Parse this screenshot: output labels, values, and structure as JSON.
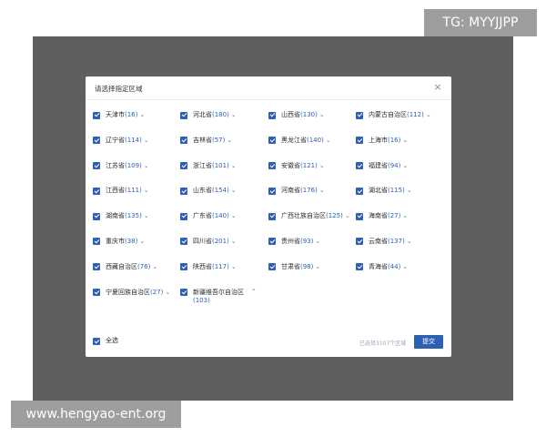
{
  "dialog": {
    "title": "请选择指定区域",
    "close_glyph": "×",
    "regions": [
      [
        {
          "name": "天津市",
          "count": "(16)"
        },
        {
          "name": "河北省",
          "count": "(180)"
        },
        {
          "name": "山西省",
          "count": "(130)"
        },
        {
          "name": "内蒙古自治区",
          "count": "(112)"
        }
      ],
      [
        {
          "name": "辽宁省",
          "count": "(114)"
        },
        {
          "name": "吉林省",
          "count": "(57)"
        },
        {
          "name": "黑龙江省",
          "count": "(140)"
        },
        {
          "name": "上海市",
          "count": "(16)"
        }
      ],
      [
        {
          "name": "江苏省",
          "count": "(109)"
        },
        {
          "name": "浙江省",
          "count": "(101)"
        },
        {
          "name": "安徽省",
          "count": "(121)"
        },
        {
          "name": "福建省",
          "count": "(94)"
        }
      ],
      [
        {
          "name": "江西省",
          "count": "(111)"
        },
        {
          "name": "山东省",
          "count": "(154)"
        },
        {
          "name": "河南省",
          "count": "(176)"
        },
        {
          "name": "湖北省",
          "count": "(115)"
        }
      ],
      [
        {
          "name": "湖南省",
          "count": "(135)"
        },
        {
          "name": "广东省",
          "count": "(140)"
        },
        {
          "name": "广西壮族自治区",
          "count": "(125)"
        },
        {
          "name": "海南省",
          "count": "(27)"
        }
      ],
      [
        {
          "name": "重庆市",
          "count": "(38)"
        },
        {
          "name": "四川省",
          "count": "(201)"
        },
        {
          "name": "贵州省",
          "count": "(93)"
        },
        {
          "name": "云南省",
          "count": "(137)"
        }
      ],
      [
        {
          "name": "西藏自治区",
          "count": "(76)"
        },
        {
          "name": "陕西省",
          "count": "(117)"
        },
        {
          "name": "甘肃省",
          "count": "(98)"
        },
        {
          "name": "青海省",
          "count": "(44)"
        }
      ],
      [
        {
          "name": "宁夏回族自治区",
          "count": "(27)"
        },
        {
          "name": "新疆维吾尔自治区",
          "count": "(103)"
        }
      ]
    ],
    "chevron_glyph": "⌄",
    "select_all_label": "全选",
    "summary": "已选择3107个区域",
    "submit_label": "提交"
  },
  "watermarks": {
    "top_right": "TG: MYYJJPP",
    "bottom_left": "www.hengyao-ent.org"
  },
  "colors": {
    "accent": "#2d5fb3",
    "overlay": "#5f5f5f",
    "badge": "#9e9e9e"
  },
  "icons": {
    "checkbox": "checkbox-checked-icon",
    "chevron": "chevron-down-icon",
    "close": "close-icon"
  }
}
